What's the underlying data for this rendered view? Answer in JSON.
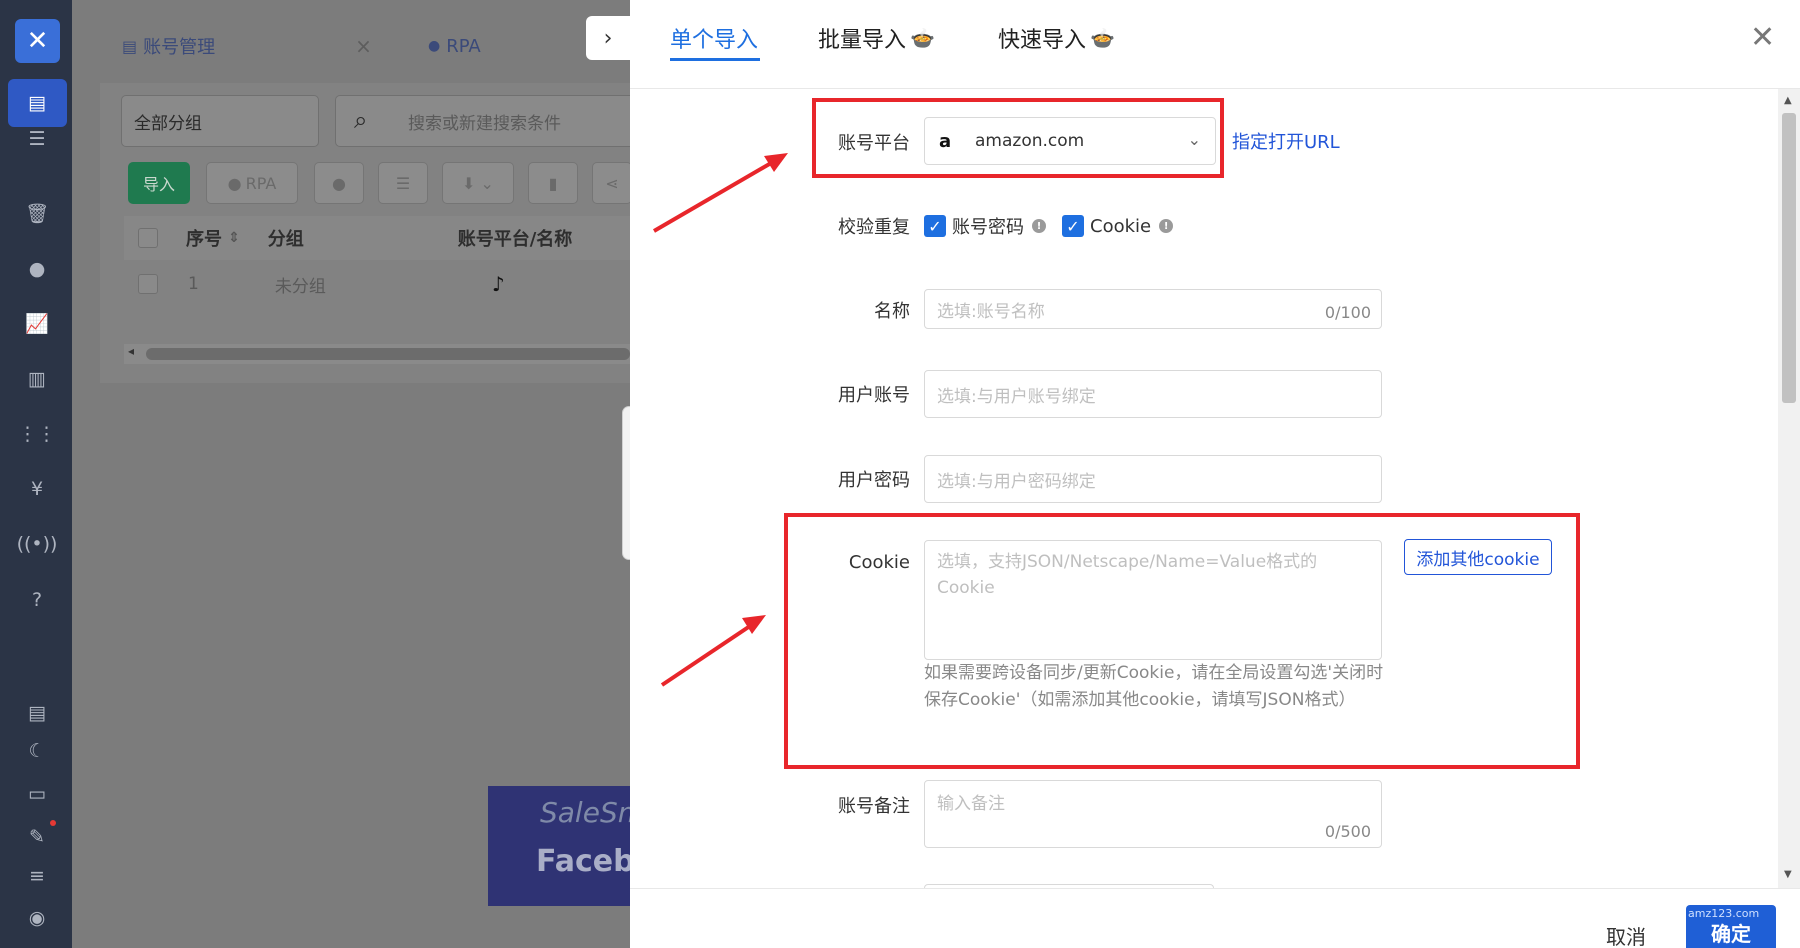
{
  "app": {
    "tabs": [
      {
        "label": "账号管理",
        "active": true
      },
      {
        "label": "RPA",
        "active": false
      }
    ],
    "group_select": "全部分组",
    "search_placeholder": "搜索或新建搜索条件",
    "toolbar": {
      "import_label": "导入",
      "rpa_label": "RPA"
    },
    "table": {
      "headers": [
        "序号",
        "分组",
        "账号平台/名称"
      ],
      "rows": [
        {
          "index": "1",
          "group": "未分组",
          "platform_icon": "tiktok-icon"
        }
      ]
    },
    "banner": {
      "line1": "SaleSm",
      "line2": "Facebo"
    }
  },
  "sidebar": {
    "icons": [
      "logo-icon",
      "account-list-icon",
      "server-icon",
      "trash-icon",
      "rpa-icon",
      "chart-icon",
      "building-icon",
      "apps-grid-icon",
      "yen-icon",
      "signal-icon",
      "help-icon",
      "document-icon",
      "moon-icon",
      "terminal-icon",
      "pen-icon",
      "menu-icon",
      "user-avatar-icon"
    ]
  },
  "drawer": {
    "tabs": [
      {
        "label": "单个导入",
        "active": true,
        "emoji": ""
      },
      {
        "label": "批量导入",
        "active": false,
        "emoji": "🍲"
      },
      {
        "label": "快速导入",
        "active": false,
        "emoji": "🍲"
      }
    ],
    "form": {
      "platform": {
        "label": "账号平台",
        "value": "amazon.com",
        "logo": "a",
        "link": "指定打开URL"
      },
      "dedupe": {
        "label": "校验重复",
        "options": [
          {
            "label": "账号密码",
            "checked": true
          },
          {
            "label": "Cookie",
            "checked": true
          }
        ]
      },
      "name": {
        "label": "名称",
        "placeholder": "选填:账号名称",
        "counter": "0/100"
      },
      "user_account": {
        "label": "用户账号",
        "placeholder": "选填:与用户账号绑定"
      },
      "user_password": {
        "label": "用户密码",
        "placeholder": "选填:与用户密码绑定"
      },
      "cookie": {
        "label": "Cookie",
        "placeholder": "选填，支持JSON/Netscape/Name=Value格式的Cookie",
        "add_button": "添加其他cookie",
        "help": "如果需要跨设备同步/更新Cookie，请在全局设置勾选'关闭时保存Cookie'（如需添加其他cookie，请填写JSON格式）"
      },
      "remark": {
        "label": "账号备注",
        "placeholder": "输入备注",
        "counter": "0/500"
      }
    },
    "footer": {
      "cancel": "取消",
      "ok": "确定",
      "watermark": "amz123.com"
    }
  },
  "colors": {
    "accent": "#1e6fe0",
    "highlight": "#e8262b",
    "sidebar": "#2b3446"
  }
}
